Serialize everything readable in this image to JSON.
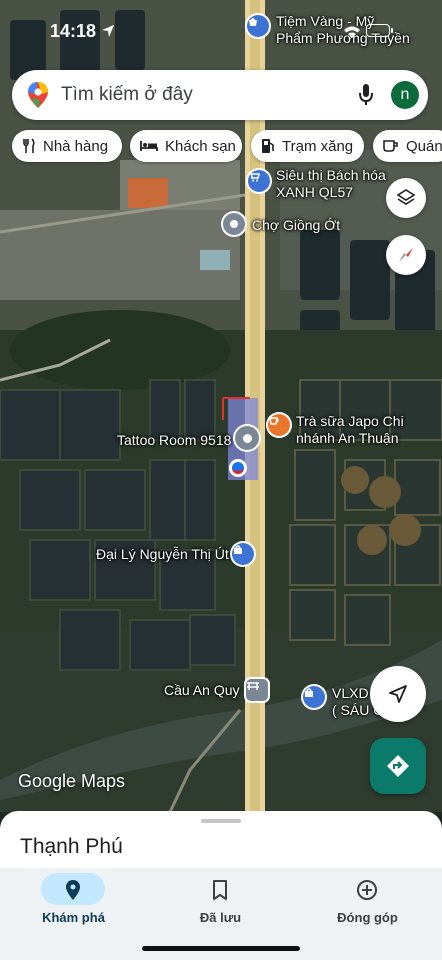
{
  "status": {
    "time": "14:18"
  },
  "search": {
    "placeholder": "Tìm kiếm ở đây",
    "avatar_initial": "n"
  },
  "chips": [
    {
      "label": "Nhà hàng",
      "icon": "fork-knife-icon"
    },
    {
      "label": "Khách sạn",
      "icon": "bed-icon"
    },
    {
      "label": "Trạm xăng",
      "icon": "gas-pump-icon"
    },
    {
      "label": "Quán",
      "icon": "coffee-cup-icon"
    }
  ],
  "map_labels": {
    "poi1": "Tiệm Vàng - Mỹ\nPhẩm Phương Tuyền",
    "poi2": "Siêu thị Bách hóa\nXANH QL57",
    "poi3": "Chợ Giồng Ớt",
    "poi4": "Trà sữa Japo Chi\nnhánh An Thuận",
    "poi5": "Tattoo Room 9518",
    "poi6": "Đại Lý Nguyễn Thị Út",
    "poi7": "Cầu An Quy",
    "poi8": "VLXD\n( SÁU C"
  },
  "watermark": "Google Maps",
  "sheet": {
    "title": "Thạnh Phú"
  },
  "nav": [
    {
      "label": "Khám phá",
      "icon": "explore-pin-icon",
      "active": true
    },
    {
      "label": "Đã lưu",
      "icon": "bookmark-icon",
      "active": false
    },
    {
      "label": "Đóng góp",
      "icon": "add-circle-icon",
      "active": false
    }
  ],
  "colors": {
    "accent": "#0b7a6a",
    "road": "#e8d49a",
    "active_pill": "#c2e7ff"
  }
}
